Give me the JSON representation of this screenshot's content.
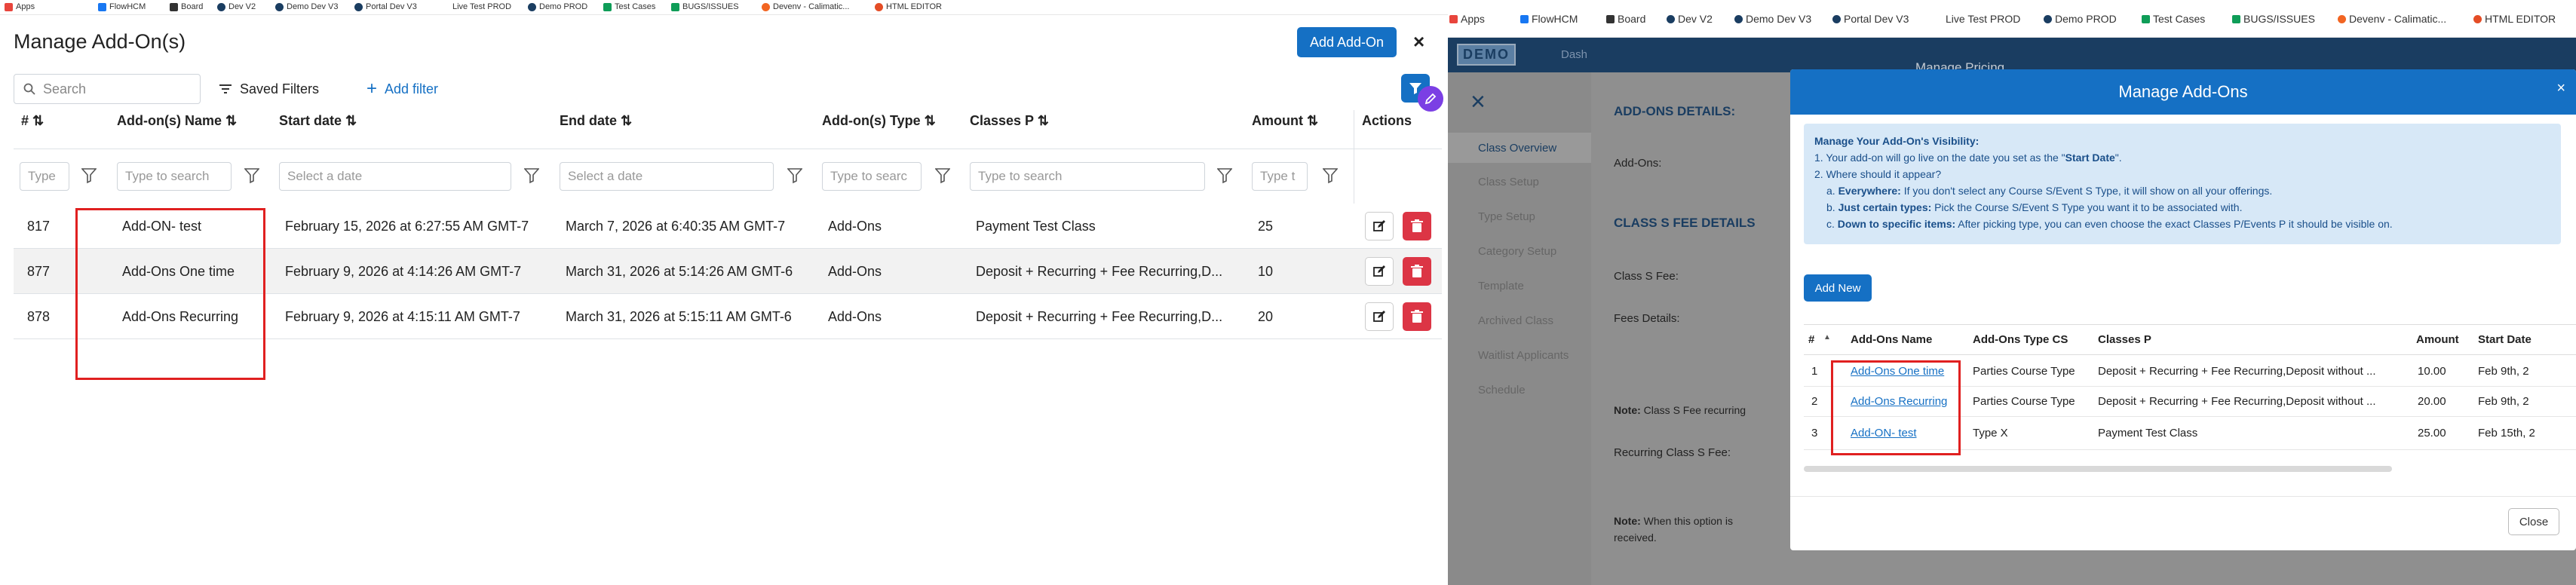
{
  "bookmarks": [
    {
      "label": "Apps",
      "icon": "apps-grid-icon",
      "color": "#e8453c"
    },
    {
      "label": "FlowHCM",
      "icon": "facebook-icon",
      "color": "#1877f2"
    },
    {
      "label": "Board",
      "icon": "grid-icon",
      "color": "#333333"
    },
    {
      "label": "Dev V2",
      "icon": "site-icon",
      "color": "#1a3d61"
    },
    {
      "label": "Demo Dev V3",
      "icon": "site-icon",
      "color": "#1a3d61"
    },
    {
      "label": "Portal Dev V3",
      "icon": "site-icon",
      "color": "#1a3d61"
    },
    {
      "label": "Live Test PROD",
      "icon": "none",
      "color": "#ffffff"
    },
    {
      "label": "Demo PROD",
      "icon": "site-icon",
      "color": "#1a3d61"
    },
    {
      "label": "Test Cases",
      "icon": "sheets-icon",
      "color": "#0f9d58"
    },
    {
      "label": "BUGS/ISSUES",
      "icon": "sheets-icon",
      "color": "#0f9d58"
    },
    {
      "label": "Devenv - Calimatic...",
      "icon": "calimatic-icon",
      "color": "#f26522"
    },
    {
      "label": "HTML EDITOR",
      "icon": "editor-icon",
      "color": "#e44d26"
    }
  ],
  "left": {
    "title": "Manage Add-On(s)",
    "add_button": "Add Add-On",
    "close": "×",
    "search_placeholder": "Search",
    "saved_filters": "Saved Filters",
    "add_filter": "Add filter",
    "columns": [
      "#",
      "Add-on(s) Name",
      "Start date",
      "End date",
      "Add-on(s) Type",
      "Classes P",
      "Amount",
      "Actions"
    ],
    "filters": [
      "Type",
      "Type to search",
      "Select a date",
      "Select a date",
      "Type to searc",
      "Type to search",
      "Type t"
    ],
    "rows": [
      {
        "id": "817",
        "name": "Add-ON- test",
        "start": "February 15, 2026 at 6:27:55 AM GMT-7",
        "end": "March 7, 2026 at 6:40:35 AM GMT-7",
        "type": "Add-Ons",
        "classes": "Payment Test Class",
        "amount": "25"
      },
      {
        "id": "877",
        "name": "Add-Ons One time",
        "start": "February 9, 2026 at 4:14:26 AM GMT-7",
        "end": "March 31, 2026 at 5:14:26 AM GMT-6",
        "type": "Add-Ons",
        "classes": "Deposit + Recurring + Fee Recurring,D...",
        "amount": "10"
      },
      {
        "id": "878",
        "name": "Add-Ons Recurring",
        "start": "February 9, 2026 at 4:15:11 AM GMT-7",
        "end": "March 31, 2026 at 5:15:11 AM GMT-6",
        "type": "Add-Ons",
        "classes": "Deposit + Recurring + Fee Recurring,D...",
        "amount": "20"
      }
    ]
  },
  "right": {
    "brand": "DEMO",
    "nav_faded": "Dash",
    "page_title_faded": "Manage Pricing",
    "sidebar": [
      "Class Overview",
      "Class Setup",
      "Type Setup",
      "Category Setup",
      "Template",
      "Archived Class",
      "Waitlist Applicants",
      "Schedule"
    ],
    "bg": {
      "addons_details": "ADD-ONS DETAILS:",
      "addons_label": "Add-Ons:",
      "fee_details": "CLASS S FEE DETAILS",
      "class_fee": "Class S Fee:",
      "fees_details": "Fees Details:",
      "note1_label": "Note:",
      "note1": "Class S Fee recurring",
      "recurring_fee": "Recurring Class S Fee:",
      "note2_label": "Note:",
      "note2": "When this option is",
      "note2b": "received."
    },
    "modal": {
      "title": "Manage Add-Ons",
      "close": "×",
      "info_title": "Manage Your Add-On's Visibility:",
      "info_1a": "1. Your add-on will go live on the date you set as the \"",
      "info_1b": "Start Date",
      "info_1c": "\".",
      "info_2": "2. Where should it appear?",
      "info_a_label": "Everywhere:",
      "info_a": " If you don't select any Course S/Event S Type, it will show on all your offerings.",
      "info_b_label": "Just certain types:",
      "info_b": " Pick the Course S/Event S Type you want it to be associated with.",
      "info_c_label": "Down to specific items:",
      "info_c": " After picking type, you can even choose the exact Classes P/Events P it should be visible on.",
      "new_button": "Add New",
      "columns": [
        "#",
        "Add-Ons Name",
        "Add-Ons Type CS",
        "Classes P",
        "Amount",
        "Start Date"
      ],
      "rows": [
        {
          "n": "1",
          "name": "Add-Ons One time",
          "type": "Parties Course Type",
          "classes": "Deposit + Recurring + Fee Recurring,Deposit without ...",
          "amount": "10.00",
          "start": "Feb 9th, 2"
        },
        {
          "n": "2",
          "name": "Add-Ons Recurring",
          "type": "Parties Course Type",
          "classes": "Deposit + Recurring + Fee Recurring,Deposit without ...",
          "amount": "20.00",
          "start": "Feb 9th, 2"
        },
        {
          "n": "3",
          "name": "Add-ON- test",
          "type": "Type X",
          "classes": "Payment Test Class",
          "amount": "25.00",
          "start": "Feb 15th, 2"
        }
      ],
      "close_button": "Close"
    }
  }
}
